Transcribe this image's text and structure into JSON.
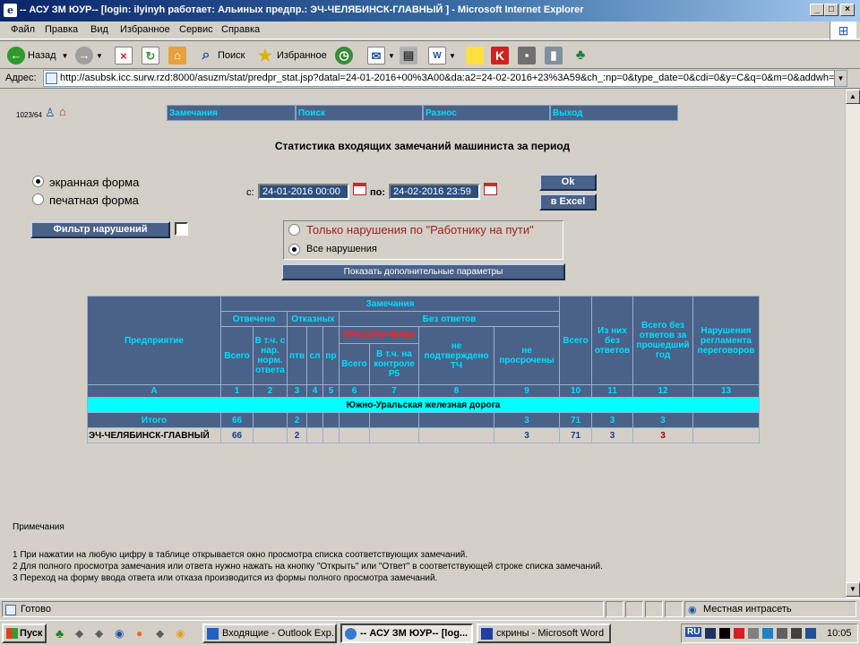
{
  "window": {
    "title": "-- АСУ ЗМ ЮУР-- [login: ilyinyh работает: Альиных предпр.: ЭЧ-ЧЕЛЯБИНСК-ГЛАВНЫЙ ] - Microsoft Internet Explorer"
  },
  "menu": [
    "Файл",
    "Правка",
    "Вид",
    "Избранное",
    "Сервис",
    "Справка"
  ],
  "toolbar": {
    "back": "Назад",
    "search": "Поиск",
    "favorites": "Избранное"
  },
  "address": {
    "label": "Адрес:",
    "url": "http://asubsk.icc.surw.rzd:8000/asuzm/stat/predpr_stat.jsp?datal=24-01-2016+00%3A00&da:a2=24-02-2016+23%3A59&ch_:np=0&type_date=0&cdi=0&y=C&q=0&m=0&addwh=&v11=0"
  },
  "page": {
    "corner_id": "1023/64",
    "nav": [
      "Замечания",
      "Поиск",
      "Разнос",
      "Выход"
    ],
    "title": "Статистика входящих замечаний машиниста за период",
    "form_options": [
      "экранная форма",
      "печатная форма"
    ],
    "date_from_label": "с:",
    "date_from": "24-01-2016 00:00",
    "date_to_label": "по:",
    "date_to": "24-02-2016 23:59",
    "ok_label": "Ok",
    "excel_label": "в Excel",
    "filter_label": "Фильтр нарушений",
    "scope_options": [
      "Только нарушения по \"Работнику на пути\"",
      "Все нарушения"
    ],
    "show_params_label": "Показать дополнительные параметры"
  },
  "table": {
    "h_remarks": "Замечания",
    "h_enterprise": "Предприятие",
    "h_answered": "Отвечено",
    "h_refusals": "Отказных",
    "h_no_answer": "Без ответов",
    "h_total": "Всего",
    "h_of_them_no_answer": "Из них без ответов",
    "h_total_no_answer_prev_year": "Всего без ответов за прошедший год",
    "h_violations": "Нарушения регламента переговоров",
    "h_ans_total": "Всего",
    "h_ans_violation": "В т.ч. с нар. норм. ответа",
    "h_ptv": "птв",
    "h_sl": "сл",
    "h_pr": "пр",
    "h_overdue": "ПРОСРОЧЕНЫ",
    "h_not_confirmed": "не подтверждено ТЧ",
    "h_not_overdue": "не просрочены",
    "h_ov_total": "Всего",
    "h_ov_control": "В т.ч. на контроле Р5",
    "col_numbers": [
      "А",
      "1",
      "2",
      "3",
      "4",
      "5",
      "6",
      "7",
      "8",
      "9",
      "10",
      "11",
      "12",
      "13"
    ],
    "railway": "Южно-Уральская железная дорога",
    "rows": [
      {
        "name": "Итого",
        "c1": "66",
        "c2": "",
        "c3": "2",
        "c4": "",
        "c5": "",
        "c6": "",
        "c7": "",
        "c8": "",
        "c9": "3",
        "c10": "71",
        "c11": "3",
        "c12": "3",
        "c13": ""
      },
      {
        "name": "ЭЧ-ЧЕЛЯБИНСК-ГЛАВНЫЙ",
        "c1": "66",
        "c2": "",
        "c3": "2",
        "c4": "",
        "c5": "",
        "c6": "",
        "c7": "",
        "c8": "",
        "c9": "3",
        "c10": "71",
        "c11": "3",
        "c12": "3",
        "c13": ""
      }
    ]
  },
  "notes": {
    "title": "Примечания",
    "lines": [
      "1  При нажатии на любую цифру в таблице открывается окно просмотра списка соответствующих замечаний.",
      "2  Для полного просмотра замечания или ответа нужно нажать на кнопку \"Открыть\" или \"Ответ\" в соответствующей строке списка замечаний.",
      "3  Переход на форму ввода ответа или отказа производится из формы полного просмотра замечаний."
    ]
  },
  "status": {
    "text": "Готово",
    "zone": "Местная интрасеть"
  },
  "taskbar": {
    "start": "Пуск",
    "tasks": [
      "Входящие - Outlook Exp...",
      "-- АСУ ЗМ ЮУР-- [log...",
      "скрины - Microsoft Word"
    ],
    "lang": "RU",
    "clock": "10:05"
  }
}
